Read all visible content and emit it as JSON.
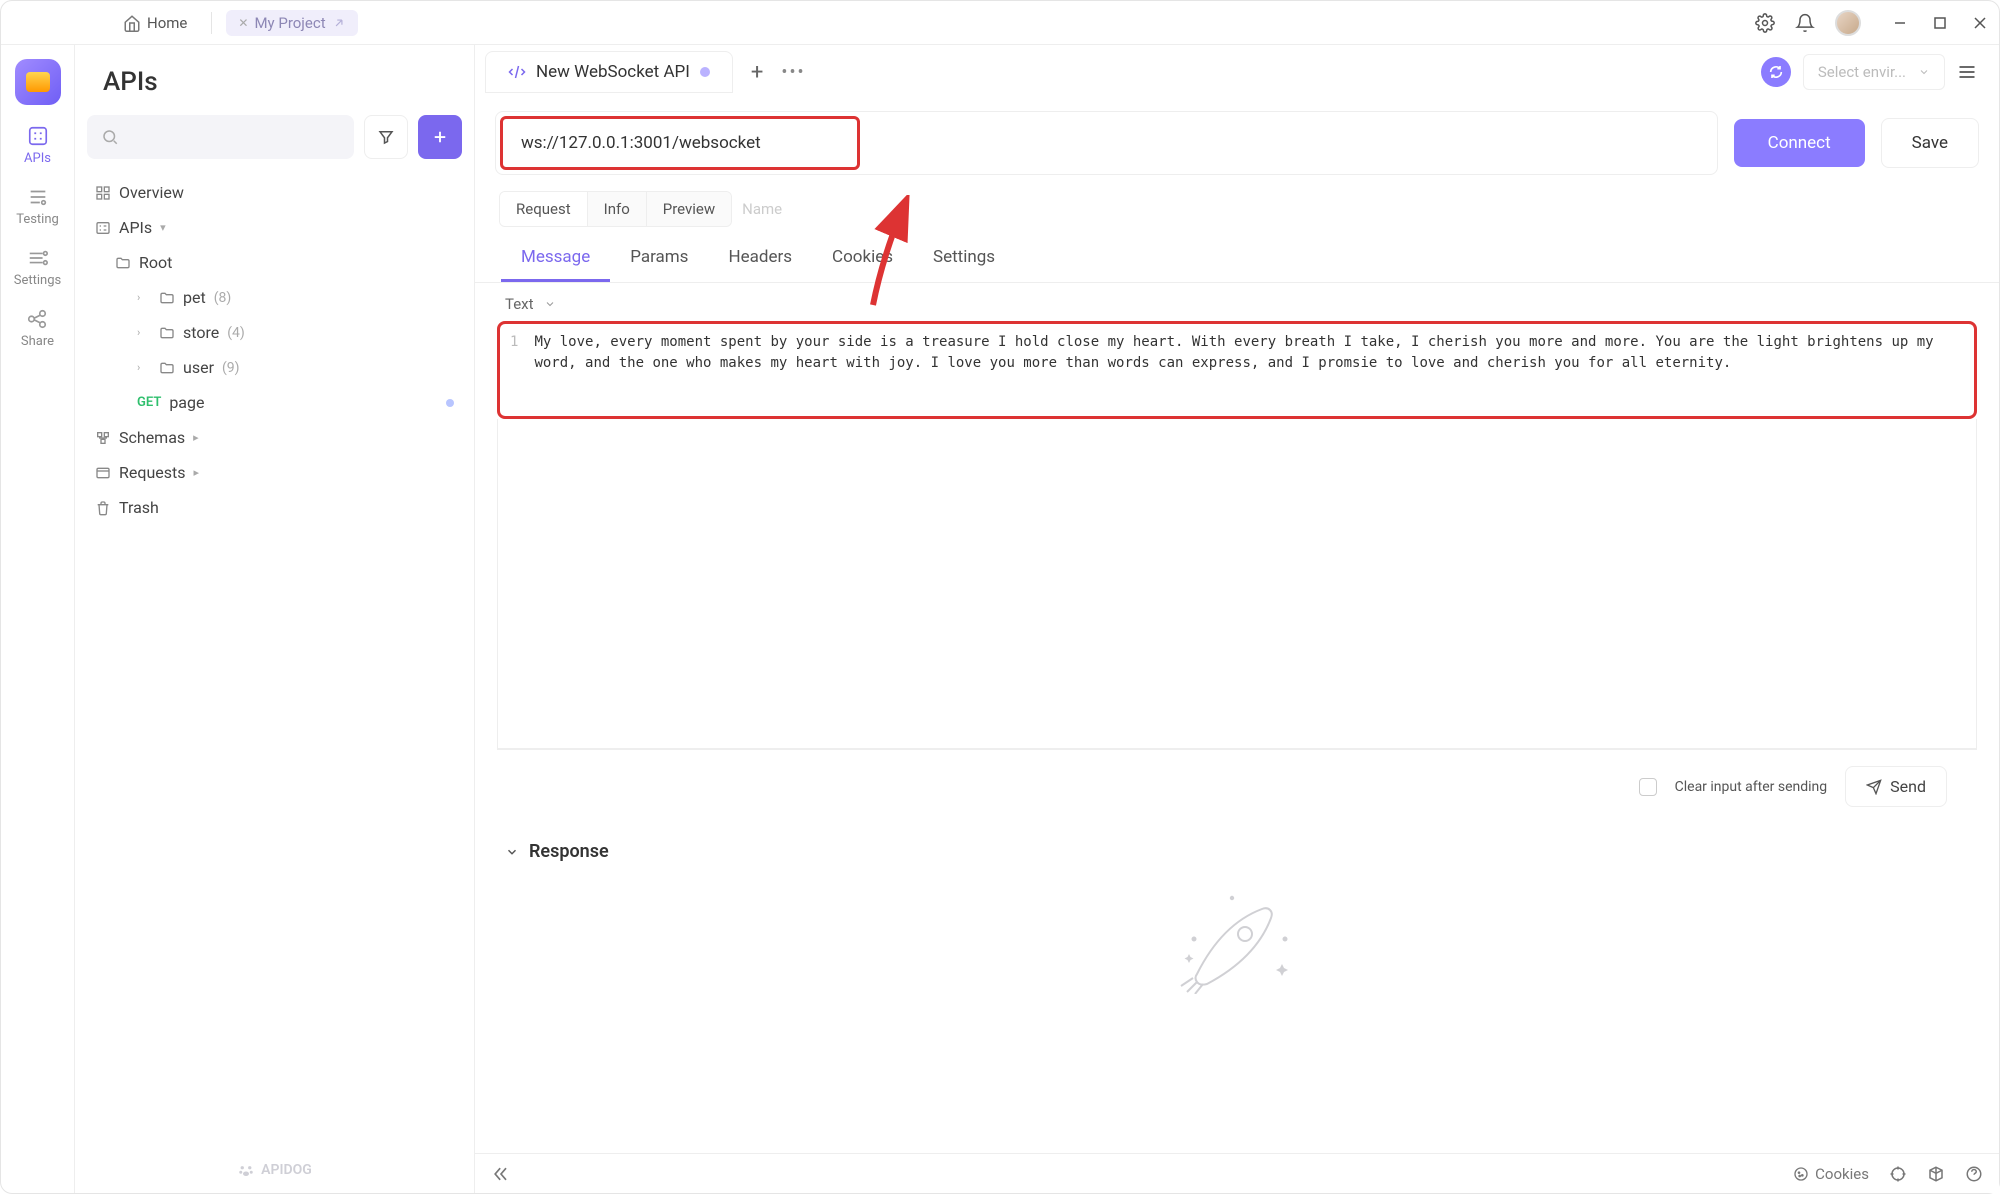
{
  "titlebar": {
    "home": "Home",
    "project": "My Project"
  },
  "rail": {
    "apis": "APIs",
    "testing": "Testing",
    "settings": "Settings",
    "share": "Share"
  },
  "sidebar": {
    "title": "APIs",
    "overview": "Overview",
    "apis_node": "APIs",
    "root": "Root",
    "pet": {
      "label": "pet",
      "count": "(8)"
    },
    "store": {
      "label": "store",
      "count": "(4)"
    },
    "user": {
      "label": "user",
      "count": "(9)"
    },
    "page": {
      "method": "GET",
      "name": "page"
    },
    "schemas": "Schemas",
    "requests": "Requests",
    "trash": "Trash",
    "footer": "APIDOG"
  },
  "tab": {
    "name": "New WebSocket API"
  },
  "env": {
    "placeholder": "Select envir..."
  },
  "url": {
    "value": "ws://127.0.0.1:3001/websocket",
    "connect": "Connect",
    "save": "Save"
  },
  "seg": {
    "request": "Request",
    "info": "Info",
    "preview": "Preview",
    "name_ph": "Name"
  },
  "msgtabs": {
    "message": "Message",
    "params": "Params",
    "headers": "Headers",
    "cookies": "Cookies",
    "settings": "Settings"
  },
  "editor": {
    "type": "Text",
    "line": "1",
    "content": "My love, every moment spent by your side is a treasure I hold close my heart. With every breath I take, I cherish you more and more. You are the light brightens up my word, and the one who makes my heart with joy. I love you more than words can express, and I promsie to love and cherish you for all eternity."
  },
  "sendrow": {
    "clear": "Clear input after sending",
    "send": "Send"
  },
  "response": {
    "title": "Response"
  },
  "status": {
    "cookies": "Cookies"
  }
}
